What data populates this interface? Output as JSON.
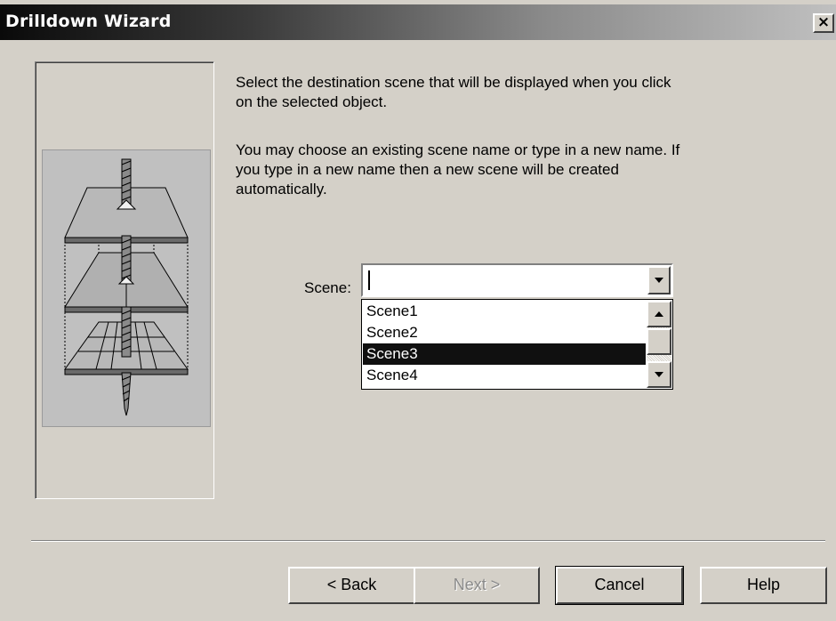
{
  "window": {
    "title": "Drilldown Wizard",
    "close_label": "×"
  },
  "description": {
    "paragraph1_line1": "Select the destination scene that will be displayed when you click",
    "paragraph1_line2": "on the selected object.",
    "paragraph2_line1": "You may choose an existing scene name or type in a new name. If",
    "paragraph2_line2": "you type in a new name then a new scene will be created",
    "paragraph2_line3": "automatically."
  },
  "scene_field": {
    "label": "Scene:",
    "value": "",
    "options": [
      "Scene1",
      "Scene2",
      "Scene3",
      "Scene4"
    ],
    "highlighted": "Scene3"
  },
  "buttons": {
    "back": "< Back",
    "next": "Next >",
    "cancel": "Cancel",
    "help": "Help"
  },
  "illustration": {
    "icon": "drilldown-layers-illustration"
  }
}
